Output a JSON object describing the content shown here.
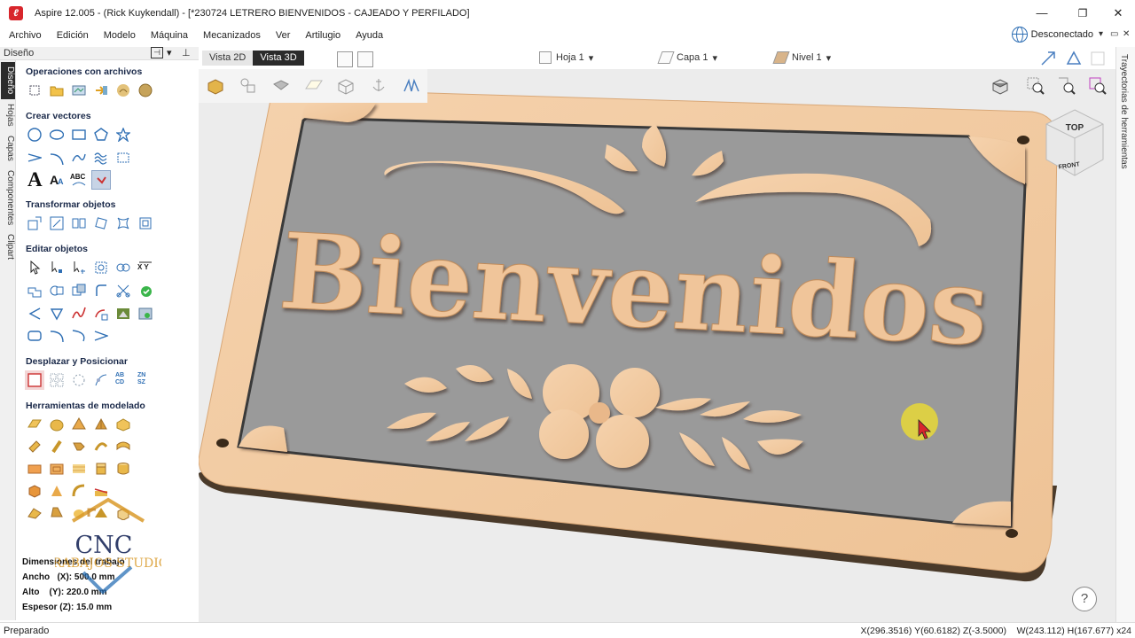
{
  "window": {
    "title": "Aspire 12.005 - (Rick Kuykendall) - [*230724 LETRERO BIENVENIDOS - CAJEADO Y PERFILADO]",
    "minimize": "—",
    "maximize": "❐",
    "close": "✕"
  },
  "menu": [
    "Archivo",
    "Edición",
    "Modelo",
    "Máquina",
    "Mecanizados",
    "Ver",
    "Artilugio",
    "Ayuda"
  ],
  "network": {
    "label": "Desconectado",
    "icon": "globe-icon"
  },
  "panel": {
    "title": "Diseño",
    "tabs": [
      "Diseño",
      "Hojas",
      "Capas",
      "Componentes",
      "Clipart"
    ],
    "sections": [
      "Operaciones con archivos",
      "Crear vectores",
      "Transformar objetos",
      "Editar objetos",
      "Desplazar y Posicionar",
      "Herramientas de modelado"
    ],
    "job": {
      "heading": "Dimensiones del trabajo",
      "width": "Ancho   (X): 500.0 mm",
      "height": "Alto    (Y): 220.0 mm",
      "thickness": "Espesor (Z): 15.0 mm"
    },
    "watermark": {
      "line1": "CNC",
      "line2": "TRABAJOS STUDIO"
    }
  },
  "view": {
    "tabs": [
      "Vista 2D",
      "Vista 3D"
    ],
    "active_tab": "Vista 3D",
    "sheet": "Hoja 1",
    "layer": "Capa 1",
    "level": "Nivel 1",
    "cube_top": "TOP",
    "cube_front": "FRONT",
    "help": "?"
  },
  "sign": {
    "text": "Bienvenidos"
  },
  "right_panel": {
    "title": "Trayectorias de herramientas"
  },
  "status": {
    "text": "Preparado",
    "coords": "X(296.3516) Y(60.6182) Z(-3.5000)    W(243.112) H(167.677) x24"
  },
  "colors": {
    "wood": "#f2c9a0",
    "wood_edge": "#d9a878",
    "pocket": "#9a9a9a",
    "dark_tab": "#2b2b2b",
    "accent": "#1b2a4a"
  }
}
